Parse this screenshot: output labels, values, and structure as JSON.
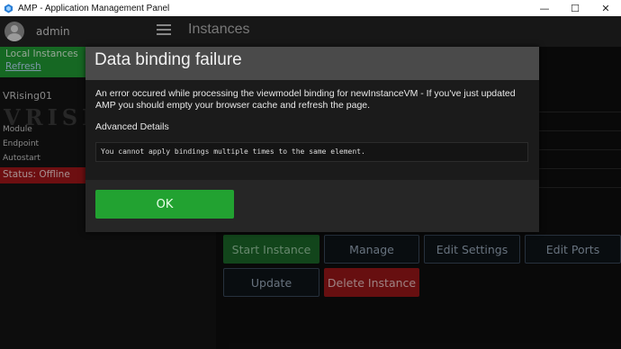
{
  "window": {
    "title": "AMP - Application Management Panel",
    "controls": {
      "minimize": "—",
      "maximize": "☐",
      "close": "✕"
    }
  },
  "header": {
    "username": "admin",
    "page_title": "Instances"
  },
  "sidebar": {
    "local_title": "Local Instances",
    "refresh": "Refresh",
    "instance_name": "VRising01",
    "logo_text": "VRISI",
    "fields": [
      "Module",
      "Endpoint",
      "Autostart"
    ],
    "status": "Status: Offline"
  },
  "actions": {
    "start": "Start Instance",
    "manage": "Manage",
    "edit_settings": "Edit Settings",
    "edit_ports": "Edit Ports",
    "update": "Update",
    "delete": "Delete Instance"
  },
  "modal": {
    "title": "Data binding failure",
    "message": "An error occured while processing the viewmodel binding for newInstanceVM - If you've just updated AMP you should empty your browser cache and refresh the page.",
    "advanced_label": "Advanced Details",
    "details": "You cannot apply bindings multiple times to the same element.",
    "ok": "OK"
  },
  "colors": {
    "accent_green": "#22a231",
    "status_red": "#a8171b",
    "delete_red": "#9e171a"
  }
}
